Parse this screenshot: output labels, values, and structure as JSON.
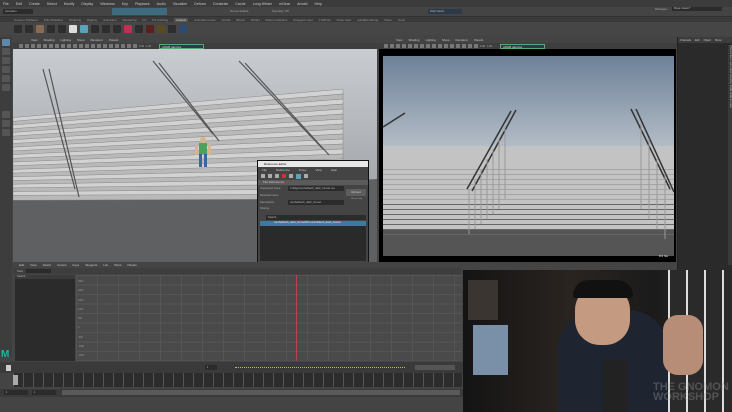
{
  "menu": [
    "File",
    "Edit",
    "Create",
    "Select",
    "Modify",
    "Display",
    "Windows",
    "Key",
    "Playback",
    "Audio",
    "Visualize",
    "Deform",
    "Constrain",
    "Cache",
    "Long Winter",
    "mGear",
    "Arnold",
    "Help"
  ],
  "status": {
    "mode": "Animation",
    "live_surface": "No Live Surface",
    "symmetry": "Symmetry: Off",
    "viewer": "Dolly Viewer",
    "workspace_label": "Workspace:",
    "workspace": "Maya Classic*"
  },
  "shelf_tabs": [
    "Curves / Surfaces",
    "Poly Modeling",
    "Sculpting",
    "Rigging",
    "Animation",
    "Rendering",
    "FX",
    "FX Caching",
    "Custom",
    "Animation Lines",
    "Arnold",
    "Bifrost",
    "MASH",
    "Motion Graphics",
    "Polygons User",
    "TURTLE",
    "XGen User",
    "quickRendering",
    "XGen",
    "Tools"
  ],
  "shelf_active": "Custom",
  "viewport_menu": [
    "View",
    "Shading",
    "Lighting",
    "Show",
    "Renderer",
    "Panels"
  ],
  "viewport_left": {
    "exposure": "0.00",
    "gamma": "1.00",
    "color_space": "sRGB gamma"
  },
  "viewport_right": {
    "exposure": "0.00",
    "gamma": "1.00",
    "color_space": "sRGB gamma",
    "fps": "8.0 fps"
  },
  "channel_box": {
    "tabs": [
      "Channels",
      "Edit",
      "Object",
      "Show"
    ],
    "side_tabs": [
      "Channel Box / Layer Editor",
      "Modeling Toolkit",
      "Attribute Editor"
    ]
  },
  "reference_editor": {
    "title": "Reference Editor",
    "menu": [
      "File",
      "Reference",
      "Proxy",
      "View",
      "Help"
    ],
    "section": "File References",
    "unresolved_label": "Unresolved name:",
    "unresolved_value": "X:/Rigs/mechahitech_dash_human.ma",
    "resolved_label": "Resolved name:",
    "namespace_label": "Namespace:",
    "namespace_value": "mechahitech_dash_human",
    "sharing_label": "Sharing:",
    "reload_label": "Reload",
    "share_label": "Share Only",
    "search_placeholder": "Search...",
    "item": "mechahitech_dash_humanRN mechahitech_dash_human"
  },
  "graph_editor": {
    "menu": [
      "Edit",
      "View",
      "Select",
      "Curves",
      "Keys",
      "Tangents",
      "List",
      "Show",
      "Panels"
    ],
    "search_placeholder": "Search...",
    "stats_label": "Stats",
    "y_ticks": [
      "2500",
      "2000",
      "1500",
      "1000",
      "500",
      "0",
      "-500",
      "-1000",
      "-1500"
    ]
  },
  "timeline": {
    "current_frame": "1",
    "start": "1",
    "end": "1"
  },
  "logo": "M",
  "watermark": "THE GNOMON WORKSHOP",
  "colors": {
    "accent": "#5ba3b8",
    "current_time": "#c0404a",
    "maya_logo": "#1fb5a5"
  }
}
